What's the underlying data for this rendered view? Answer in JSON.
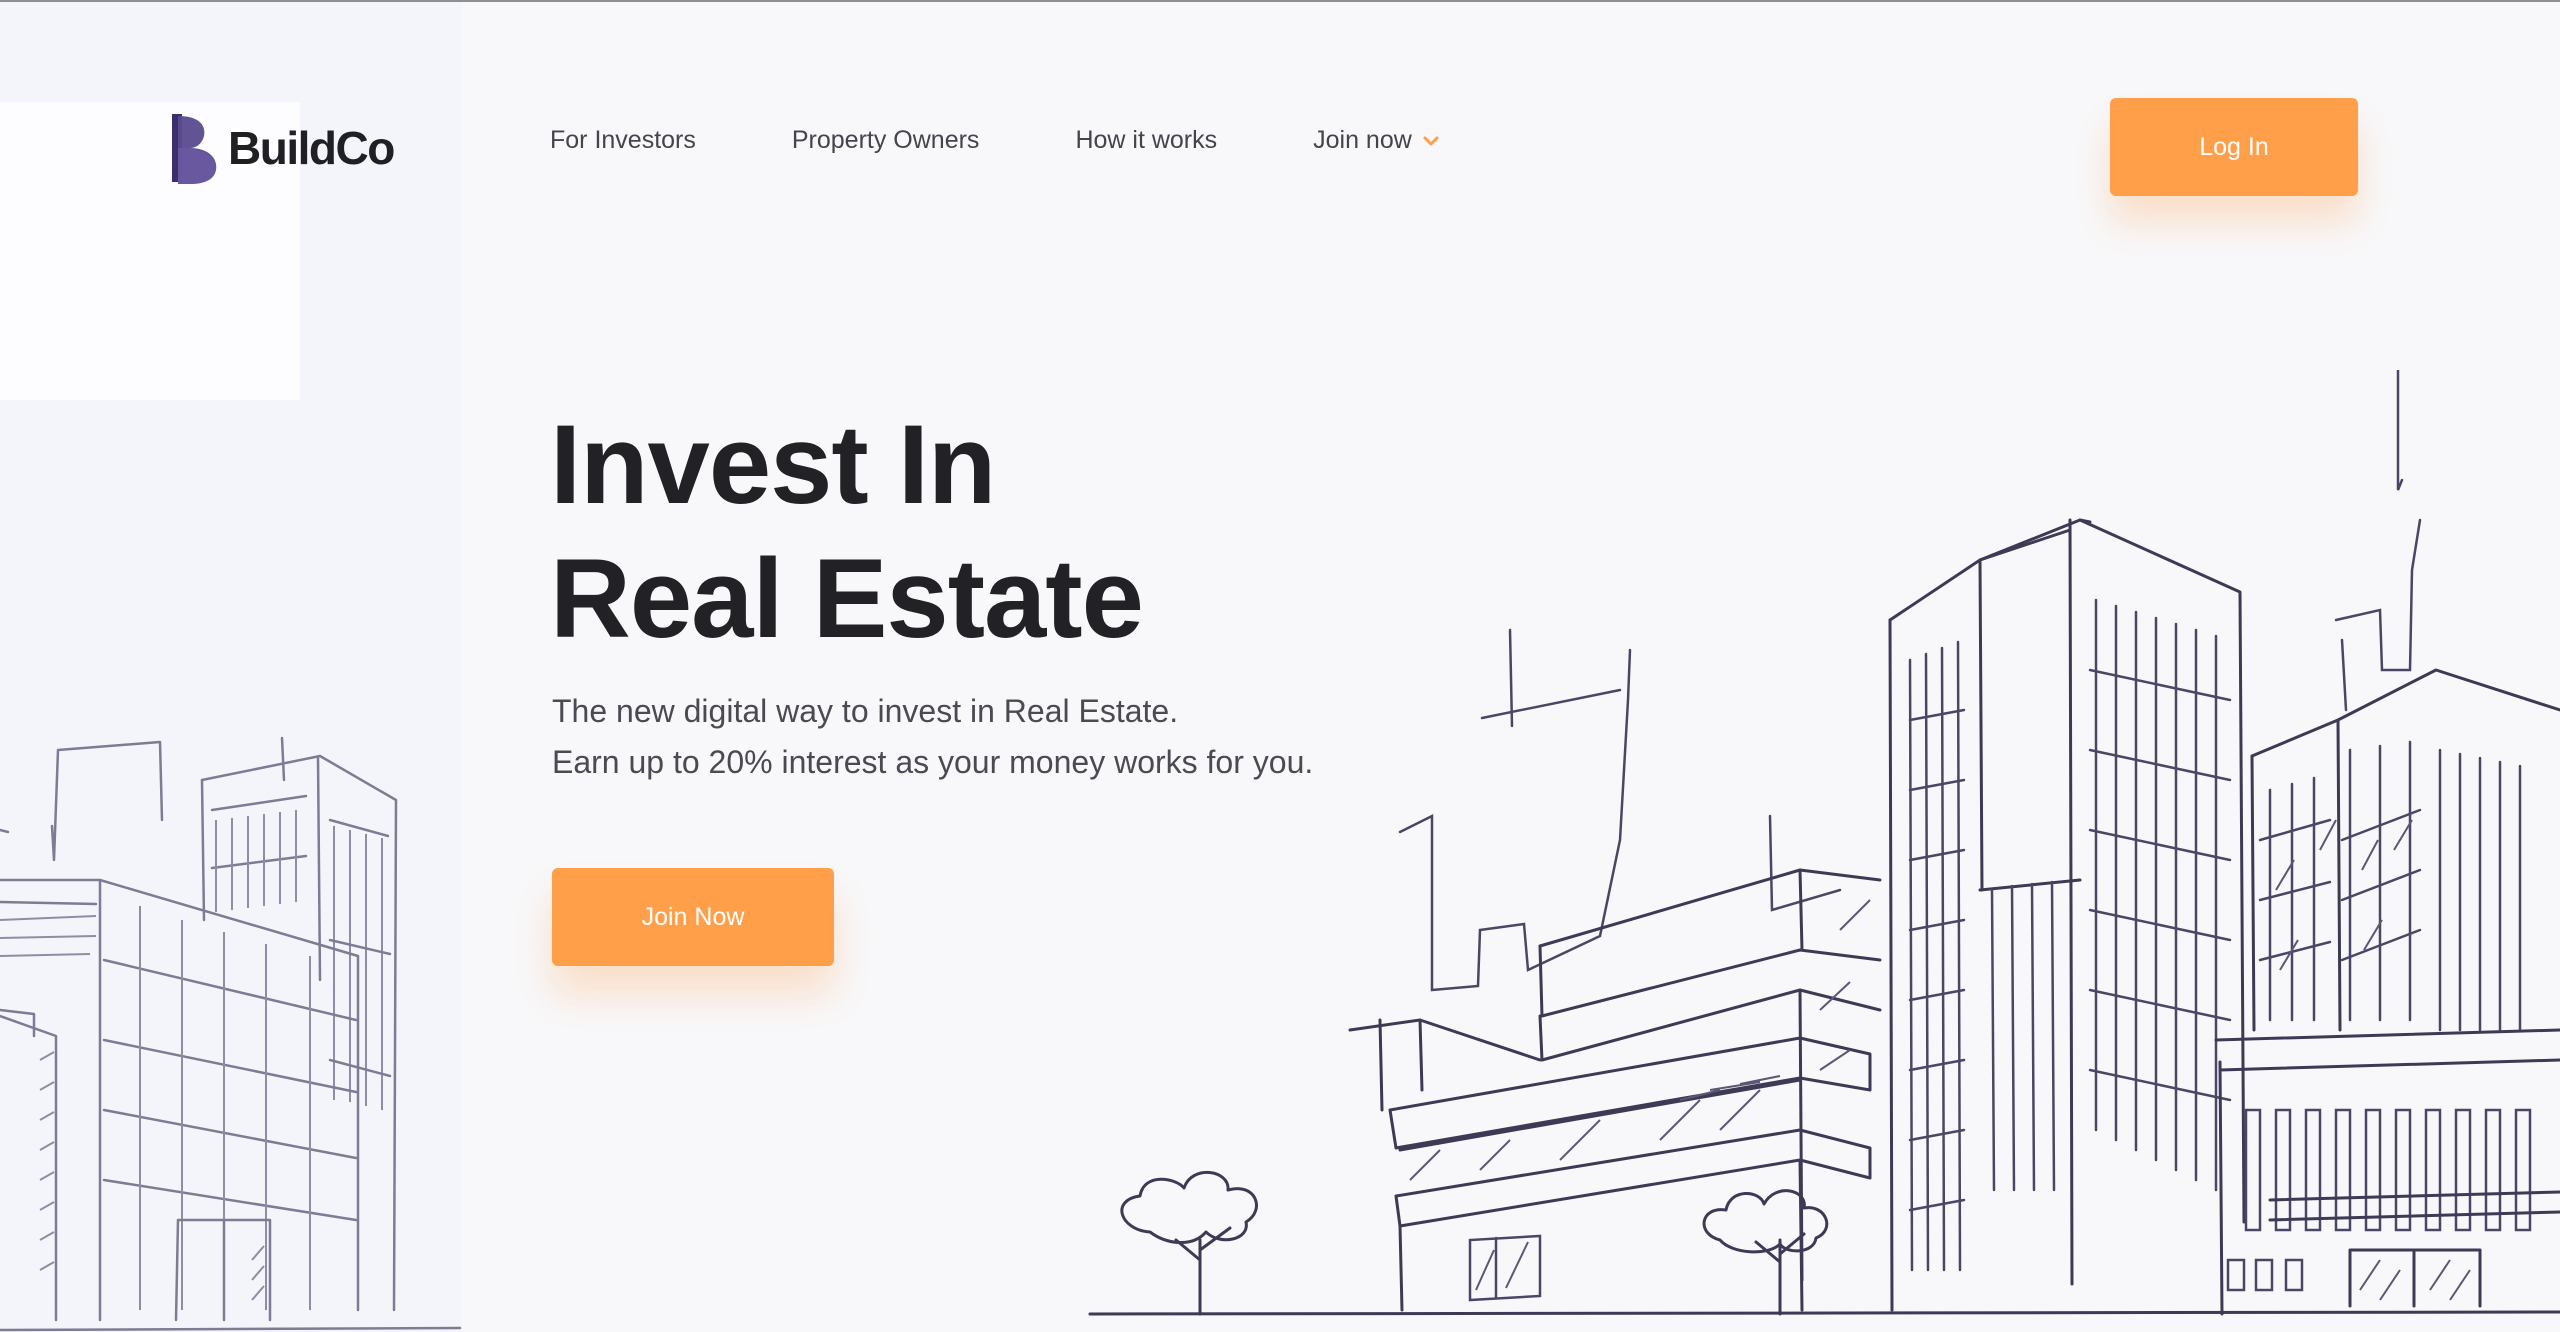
{
  "brand": {
    "name": "BuildCo",
    "logo_icon": "b-logo-icon",
    "accent_color": "#ff9f4a",
    "highlight_color": "#fed8b6",
    "logo_color": "#4b3e7a"
  },
  "nav": {
    "items": [
      {
        "label": "For Investors"
      },
      {
        "label": "Property Owners"
      },
      {
        "label": "How it works"
      },
      {
        "label": "Join now",
        "icon": "chevron-down-icon"
      }
    ],
    "login_label": "Log In"
  },
  "hero": {
    "title_line1": "Invest In",
    "title_line2": "Real Estate",
    "subtitle_line1": "The new digital way to invest in Real Estate.",
    "subtitle_line2": "Earn up to 20% interest as your money works for you.",
    "cta_label": "Join Now"
  }
}
